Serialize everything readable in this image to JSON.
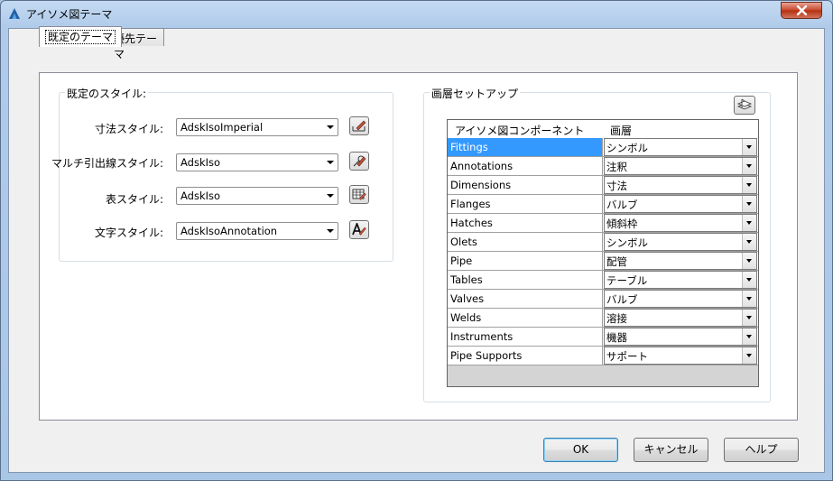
{
  "window": {
    "title": "アイソメ図テーマ"
  },
  "tabs": [
    {
      "label": "既定のテーマ",
      "active": true
    },
    {
      "label": "優先テーマ",
      "active": false
    }
  ],
  "default_styles": {
    "group_title": "既定のスタイル:",
    "rows": [
      {
        "label": "寸法スタイル:",
        "value": "AdskIsoImperial",
        "icon": "dimension-style-icon"
      },
      {
        "label": "マルチ引出線スタイル:",
        "value": "AdskIso",
        "icon": "multileader-style-icon"
      },
      {
        "label": "表スタイル:",
        "value": "AdskIso",
        "icon": "table-style-icon"
      },
      {
        "label": "文字スタイル:",
        "value": "AdskIsoAnnotation",
        "icon": "text-style-icon"
      }
    ]
  },
  "layer_setup": {
    "group_title": "画層セットアップ",
    "columns": [
      "アイソメ図コンポーネント",
      "画層"
    ],
    "rows": [
      {
        "component": "Fittings",
        "layer": "シンボル",
        "selected": true
      },
      {
        "component": "Annotations",
        "layer": "注釈"
      },
      {
        "component": "Dimensions",
        "layer": "寸法"
      },
      {
        "component": "Flanges",
        "layer": "バルブ"
      },
      {
        "component": "Hatches",
        "layer": "傾斜枠"
      },
      {
        "component": "Olets",
        "layer": "シンボル"
      },
      {
        "component": "Pipe",
        "layer": "配管"
      },
      {
        "component": "Tables",
        "layer": "テーブル"
      },
      {
        "component": "Valves",
        "layer": "バルブ"
      },
      {
        "component": "Welds",
        "layer": "溶接"
      },
      {
        "component": "Instruments",
        "layer": "機器"
      },
      {
        "component": "Pipe Supports",
        "layer": "サポート"
      }
    ]
  },
  "buttons": {
    "ok": "OK",
    "cancel": "キャンセル",
    "help": "ヘルプ"
  },
  "colors": {
    "selection": "#3399ff",
    "close": "#c7452b"
  }
}
